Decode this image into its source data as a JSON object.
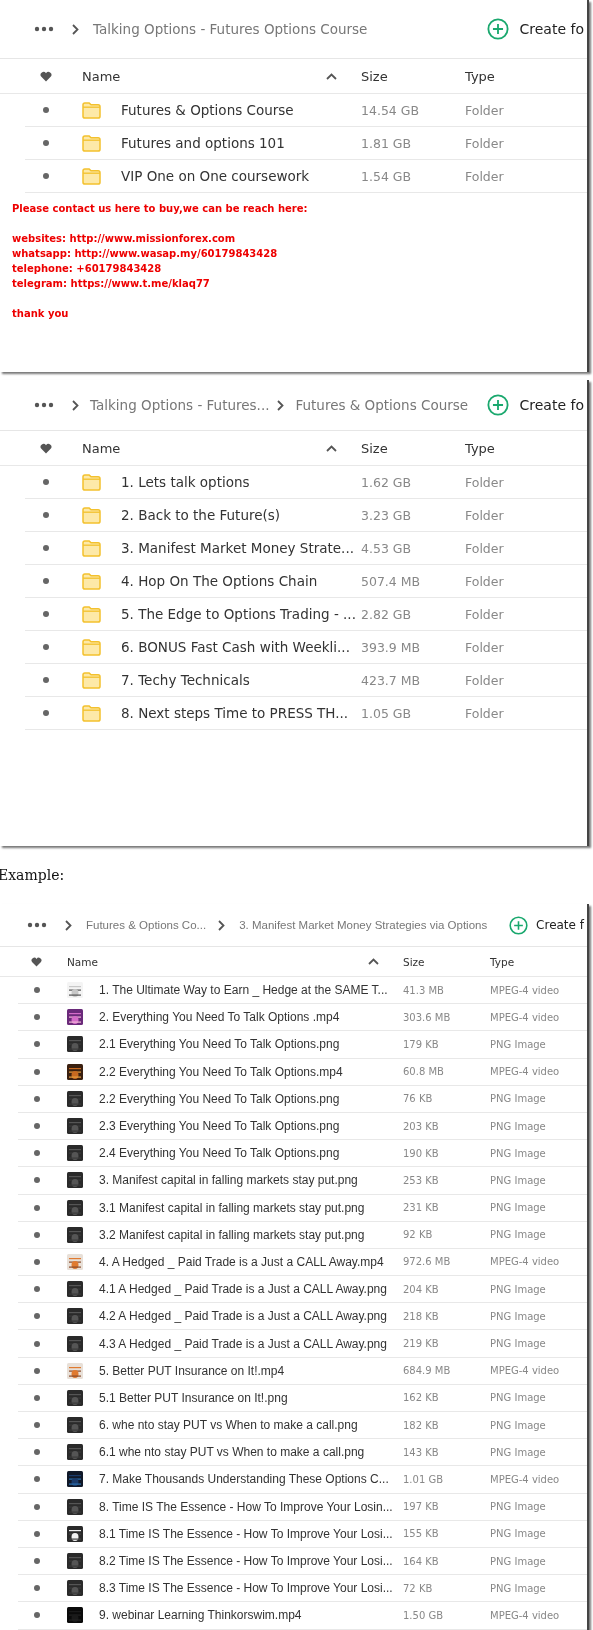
{
  "panels": [
    {
      "kind": "folders",
      "breadcrumb": [
        "Talking Options - Futures Options Course"
      ],
      "create_label": "Create fo",
      "columns": [
        "Name",
        "Size",
        "Type"
      ],
      "rows": [
        {
          "name": "Futures & Options Course",
          "size": "14.54 GB",
          "type": "Folder"
        },
        {
          "name": "Futures and options 101",
          "size": "1.81 GB",
          "type": "Folder"
        },
        {
          "name": "VIP One on One coursework",
          "size": "1.54 GB",
          "type": "Folder"
        }
      ],
      "notice": {
        "heading": "Please contact us here to buy,we can be reach here:",
        "contacts": [
          "websites: http://www.missionforex.com",
          "whatsapp: http://www.wasap.my/60179843428",
          "telephone: +60179843428",
          "telegram: https://www.t.me/klaq77"
        ],
        "closing": "thank you"
      }
    },
    {
      "kind": "folders",
      "breadcrumb": [
        "Talking Options - Futures...",
        "Futures & Options Course"
      ],
      "create_label": "Create fo",
      "columns": [
        "Name",
        "Size",
        "Type"
      ],
      "rows": [
        {
          "name": "1. Lets talk options",
          "size": "1.62 GB",
          "type": "Folder"
        },
        {
          "name": "2. Back to the Future(s)",
          "size": "3.23 GB",
          "type": "Folder"
        },
        {
          "name": "3. Manifest Market Money Strate...",
          "size": "4.53 GB",
          "type": "Folder"
        },
        {
          "name": "4. Hop On The Options Chain",
          "size": "507.4 MB",
          "type": "Folder"
        },
        {
          "name": "5. The Edge to Options Trading - ...",
          "size": "2.82 GB",
          "type": "Folder"
        },
        {
          "name": "6. BONUS Fast Cash with Weekli...",
          "size": "393.9 MB",
          "type": "Folder"
        },
        {
          "name": "7. Techy Technicals",
          "size": "423.7 MB",
          "type": "Folder"
        },
        {
          "name": "8. Next steps Time to PRESS TH...",
          "size": "1.05 GB",
          "type": "Folder"
        }
      ]
    },
    {
      "kind": "caption",
      "text": "Example:"
    },
    {
      "kind": "files",
      "breadcrumb": [
        "Futures & Options Co...",
        "3. Manifest Market Money Strategies via Options"
      ],
      "create_label": "Create f",
      "columns": [
        "Name",
        "Size",
        "Type"
      ],
      "rows": [
        {
          "kind": "page",
          "name": "1. The Ultimate Way to Earn _ Hedge at the SAME T...",
          "size": "41.3 MB",
          "type": "MPEG-4 video"
        },
        {
          "kind": "purple",
          "name": "2. Everything You Need To Talk Options .mp4",
          "size": "303.6 MB",
          "type": "MPEG-4 video"
        },
        {
          "kind": "dark",
          "name": "2.1 Everything You Need To Talk Options.png",
          "size": "179 KB",
          "type": "PNG Image"
        },
        {
          "kind": "warm",
          "name": "2.2 Everything You Need To Talk Options.mp4",
          "size": "60.8 MB",
          "type": "MPEG-4 video"
        },
        {
          "kind": "dark",
          "name": "2.2 Everything You Need To Talk Options.png",
          "size": "76 KB",
          "type": "PNG Image"
        },
        {
          "kind": "dark",
          "name": "2.3 Everything You Need To Talk Options.png",
          "size": "203 KB",
          "type": "PNG Image"
        },
        {
          "kind": "dark",
          "name": "2.4 Everything You Need To Talk Options.png",
          "size": "190 KB",
          "type": "PNG Image"
        },
        {
          "kind": "dark",
          "name": "3. Manifest capital in falling markets stay put.png",
          "size": "253 KB",
          "type": "PNG Image"
        },
        {
          "kind": "dark",
          "name": "3.1 Manifest capital in falling markets stay put.png",
          "size": "231 KB",
          "type": "PNG Image"
        },
        {
          "kind": "dark",
          "name": "3.2 Manifest capital in falling markets stay put.png",
          "size": "92 KB",
          "type": "PNG Image"
        },
        {
          "kind": "orange",
          "name": "4. A Hedged _ Paid Trade is a Just a CALL Away.mp4",
          "size": "972.6 MB",
          "type": "MPEG-4 video"
        },
        {
          "kind": "dark",
          "name": "4.1 A Hedged _ Paid Trade is a Just a CALL Away.png",
          "size": "204 KB",
          "type": "PNG Image"
        },
        {
          "kind": "dark",
          "name": "4.2 A Hedged _ Paid Trade is a Just a CALL Away.png",
          "size": "218 KB",
          "type": "PNG Image"
        },
        {
          "kind": "dark",
          "name": "4.3 A Hedged _ Paid Trade is a Just a CALL Away.png",
          "size": "219 KB",
          "type": "PNG Image"
        },
        {
          "kind": "orange",
          "name": "5. Better PUT Insurance on It!.mp4",
          "size": "684.9 MB",
          "type": "MPEG-4 video"
        },
        {
          "kind": "dark",
          "name": "5.1 Better PUT Insurance on It!.png",
          "size": "162 KB",
          "type": "PNG Image"
        },
        {
          "kind": "dark",
          "name": "6. whe nto stay PUT vs When to make a call.png",
          "size": "182 KB",
          "type": "PNG Image"
        },
        {
          "kind": "dark",
          "name": "6.1 whe nto stay PUT vs When to make a call.png",
          "size": "143 KB",
          "type": "PNG Image"
        },
        {
          "kind": "navy",
          "name": "7. Make Thousands Understanding These Options C...",
          "size": "1.01 GB",
          "type": "MPEG-4 video"
        },
        {
          "kind": "dark",
          "name": "8. Time IS The Essence - How To Improve Your Losin...",
          "size": "197 KB",
          "type": "PNG Image"
        },
        {
          "kind": "darkbar",
          "name": "8.1 Time IS The Essence - How To Improve Your Losi...",
          "size": "155 KB",
          "type": "PNG Image"
        },
        {
          "kind": "dark",
          "name": "8.2 Time IS The Essence - How To Improve Your Losi...",
          "size": "164 KB",
          "type": "PNG Image"
        },
        {
          "kind": "dark",
          "name": "8.3 Time IS The Essence - How To Improve Your Losi...",
          "size": "72 KB",
          "type": "PNG Image"
        },
        {
          "kind": "black",
          "name": "9. webinar Learning Thinkorswim.mp4",
          "size": "1.50 GB",
          "type": "MPEG-4 video"
        }
      ]
    }
  ]
}
